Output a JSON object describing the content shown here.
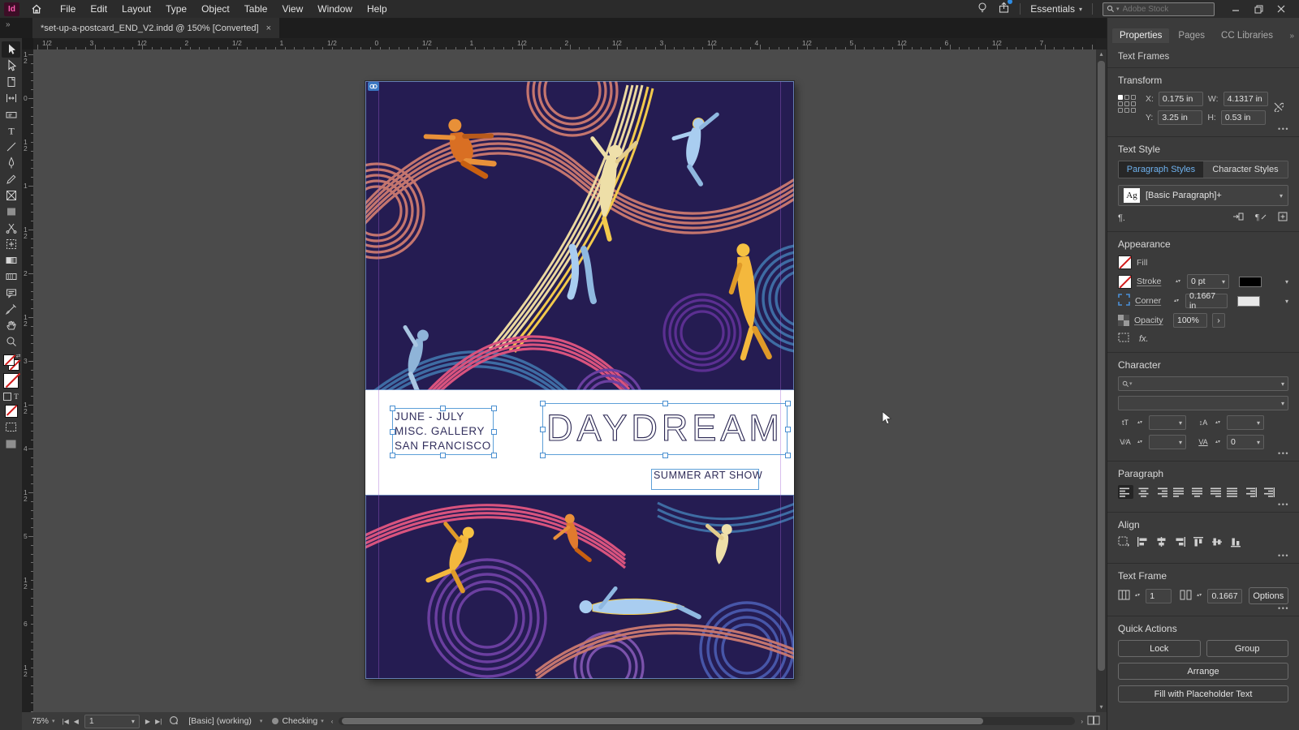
{
  "app": {
    "logo_text": "Id"
  },
  "menubar": {
    "menus": [
      "File",
      "Edit",
      "Layout",
      "Type",
      "Object",
      "Table",
      "View",
      "Window",
      "Help"
    ],
    "workspace": "Essentials",
    "search_placeholder": "Adobe Stock"
  },
  "tab": {
    "title": "*set-up-a-postcard_END_V2.indd @ 150% [Converted]",
    "close": "×"
  },
  "toolbar_tools": [
    {
      "name": "selection-tool",
      "icon": "sel",
      "active": true
    },
    {
      "name": "direct-selection-tool",
      "icon": "dsel"
    },
    {
      "name": "page-tool",
      "icon": "page"
    },
    {
      "name": "gap-tool",
      "icon": "gap"
    },
    {
      "name": "content-collector-tool",
      "icon": "coll"
    },
    {
      "name": "type-tool",
      "icon": "type"
    },
    {
      "name": "line-tool",
      "icon": "line"
    },
    {
      "name": "pen-tool",
      "icon": "pen"
    },
    {
      "name": "pencil-tool",
      "icon": "pencil"
    },
    {
      "name": "frame-tool",
      "icon": "frame"
    },
    {
      "name": "rectangle-tool",
      "icon": "rect"
    },
    {
      "name": "scissors-tool",
      "icon": "scis"
    },
    {
      "name": "free-transform-tool",
      "icon": "ft"
    },
    {
      "name": "gradient-swatch-tool",
      "icon": "grad"
    },
    {
      "name": "gradient-feather-tool",
      "icon": "feather"
    },
    {
      "name": "note-tool",
      "icon": "note"
    },
    {
      "name": "eyedropper-tool",
      "icon": "eye"
    },
    {
      "name": "hand-tool",
      "icon": "hand"
    },
    {
      "name": "zoom-tool",
      "icon": "zoom"
    }
  ],
  "rulers": {
    "horizontal_labels": [
      "1/2",
      "3",
      "1/2",
      "2",
      "1/2",
      "1",
      "1/2",
      "0",
      "1/2",
      "1",
      "1/2",
      "2",
      "1/2",
      "3",
      "1/2",
      "4",
      "1/2",
      "5",
      "1/2",
      "6",
      "1/2",
      "7"
    ],
    "vertical_labels": [
      "1/2",
      "0",
      "1/2",
      "1",
      "1/2",
      "2",
      "1/2",
      "3",
      "1/2",
      "4",
      "1/2",
      "5",
      "1/2",
      "6",
      "1/2"
    ]
  },
  "panel": {
    "tabs": [
      "Properties",
      "Pages",
      "CC Libraries"
    ],
    "selection_label": "Text Frames",
    "transform": {
      "title": "Transform",
      "x_label": "X:",
      "x": "0.175 in",
      "y_label": "Y:",
      "y": "3.25 in",
      "w_label": "W:",
      "w": "4.1317 in",
      "h_label": "H:",
      "h": "0.53 in"
    },
    "text_style": {
      "title": "Text Style",
      "tab_paragraph": "Paragraph Styles",
      "tab_character": "Character Styles",
      "badge": "Ag",
      "style_name": "[Basic Paragraph]+"
    },
    "appearance": {
      "title": "Appearance",
      "fill_label": "Fill",
      "stroke_label": "Stroke",
      "stroke_value": "0 pt",
      "corner_label": "Corner",
      "corner_value": "0.1667 in",
      "opacity_label": "Opacity",
      "opacity_value": "100%",
      "fx_label": "fx."
    },
    "character": {
      "title": "Character",
      "tracking_value": "0"
    },
    "paragraph": {
      "title": "Paragraph"
    },
    "align": {
      "title": "Align"
    },
    "text_frame": {
      "title": "Text Frame",
      "columns_value": "1",
      "inset_value": "0.1667",
      "options_label": "Options"
    },
    "quick_actions": {
      "title": "Quick Actions",
      "lock": "Lock",
      "group": "Group",
      "arrange": "Arrange",
      "fill_placeholder": "Fill with Placeholder Text"
    }
  },
  "statusbar": {
    "zoom_level": "75%",
    "page_number": "1",
    "preset": "[Basic] (working)",
    "preflight_status": "Checking"
  },
  "artboard": {
    "texts": {
      "line1": "JUNE - JULY",
      "line2": "MISC. GALLERY",
      "line3": "SAN FRANCISCO",
      "headline": "DAYDREAM",
      "subtitle": "SUMMER ART SHOW"
    }
  },
  "colors": {
    "accent_blue": "#4b8fd6",
    "selection_frame": "#5d9fd8",
    "style_tab_active_text": "#6fb2ef",
    "art_navy": "#251c52",
    "art_salmon": "#c4756e",
    "art_magenta": "#d9537e",
    "art_steel_blue": "#3e6ca3",
    "art_violet": "#6b3fa0",
    "art_yellow": "#f2c94c",
    "art_cream": "#ecd9a0",
    "art_orange": "#d96f23",
    "art_light_blue": "#a9cdf0"
  }
}
